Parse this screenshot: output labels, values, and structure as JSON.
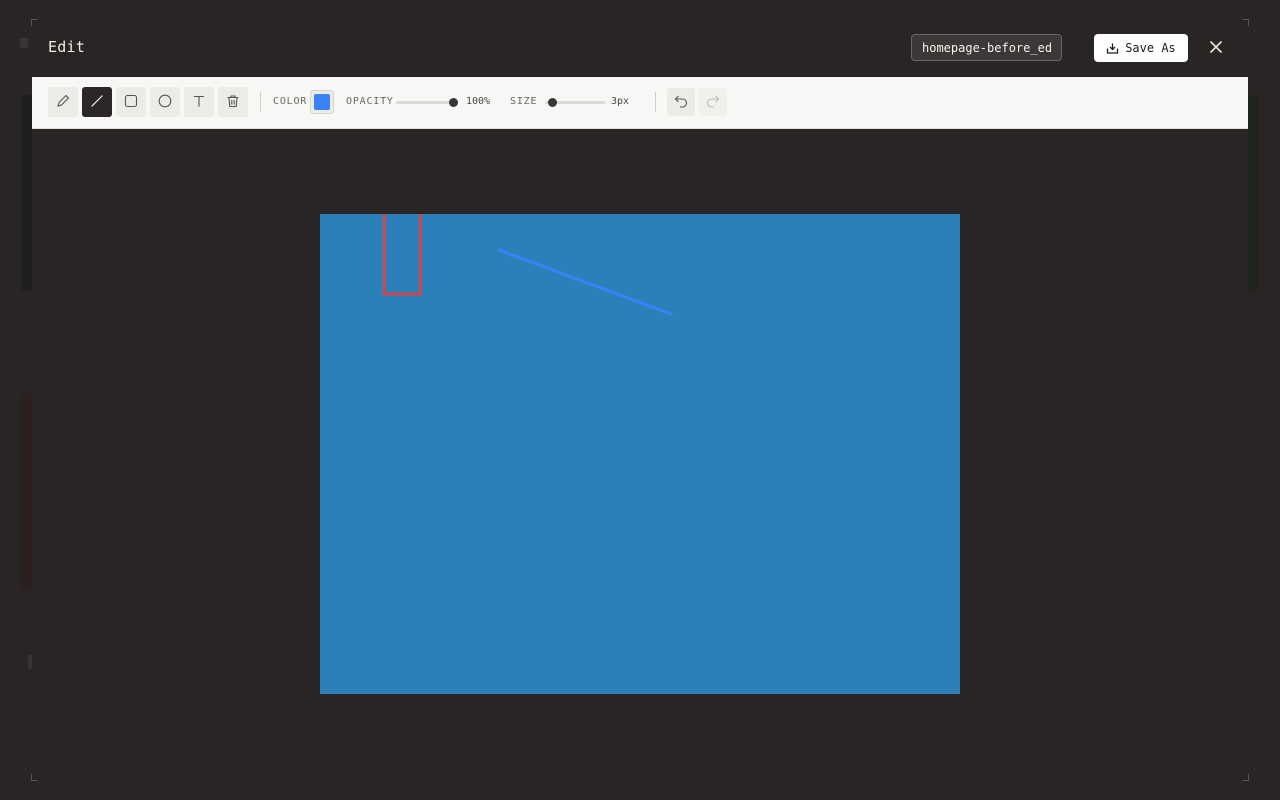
{
  "modal": {
    "title": "Edit",
    "filename_value": "homepage-before_edited",
    "save_label": "Save As"
  },
  "toolbar": {
    "tools": [
      "pencil-icon",
      "line-icon",
      "rectangle-icon",
      "ellipse-icon",
      "text-icon",
      "trash-icon"
    ],
    "active_tool": "line",
    "color_label": "COLOR",
    "color_value": "#3b82f6",
    "opacity_label": "OPACITY",
    "opacity_value": "100%",
    "opacity_fraction": 1.0,
    "size_label": "SIZE",
    "size_value": "3px",
    "size_fraction": 0.05
  },
  "canvas": {
    "background_color": "#2b80b9",
    "annotations": [
      {
        "type": "rectangle",
        "stroke": "#d0464c"
      },
      {
        "type": "line",
        "stroke": "#3b82f6"
      }
    ]
  }
}
